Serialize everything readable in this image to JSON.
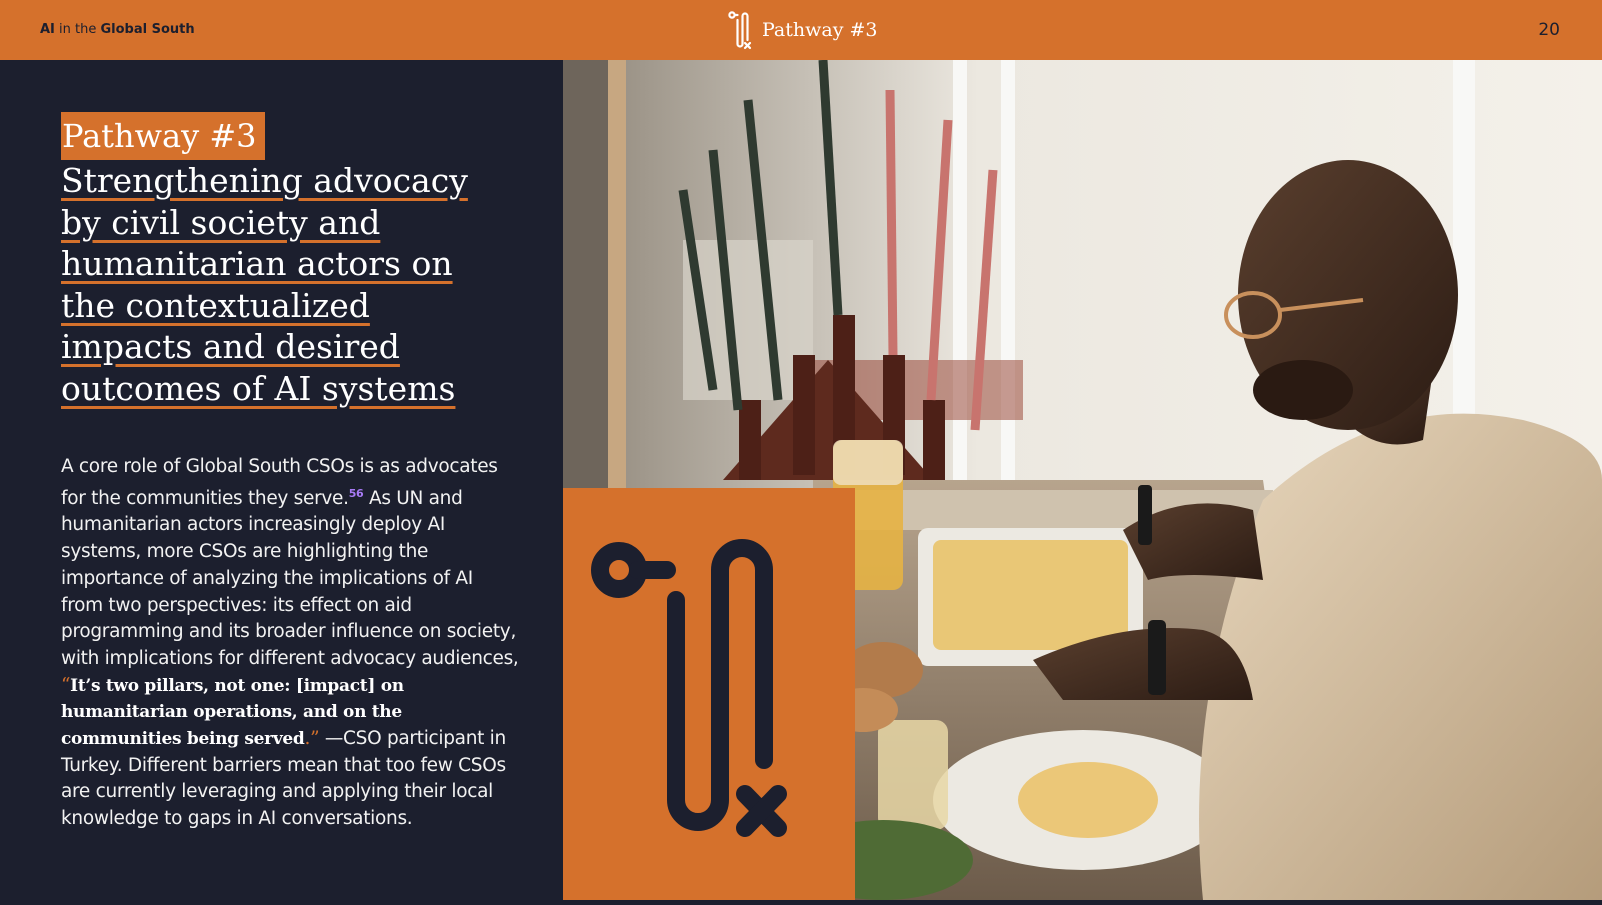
{
  "header": {
    "brand_ai": "AI",
    "brand_mid": " in the ",
    "brand_rest": "Global South",
    "section_title": "Pathway #3",
    "page_number": "20"
  },
  "content": {
    "tag": "Pathway #3",
    "heading_lines": [
      "Strengthening advocacy",
      "by civil society and",
      "humanitarian actors on",
      "the contextualized",
      "impacts and desired",
      "outcomes of AI systems"
    ],
    "body_part1": "A core role of Global South CSOs is as advocates for the communities they serve.",
    "footnote": "56",
    "body_part2": " As UN and humanitarian actors increasingly deploy AI systems, more CSOs are highlighting the importance of analyzing the implications of AI from two perspectives: its effect on aid programming and its broader influence on society, with implications for different advocacy audiences, ",
    "quote_open": "“",
    "quote": "It’s two pillars, not one: [impact] on humanitarian operations, and on the communities being served",
    "quote_close": ".”",
    "body_part3": " —CSO participant in Turkey. Different barriers mean that too few CSOs are currently leveraging and applying their local knowledge to gaps in AI conversations."
  },
  "colors": {
    "accent": "#d5712c",
    "navy": "#1c1f2e",
    "footnote": "#a77af5"
  },
  "icons": {
    "header_logo": "pathway-path-icon",
    "block_logo": "pathway-path-icon"
  }
}
